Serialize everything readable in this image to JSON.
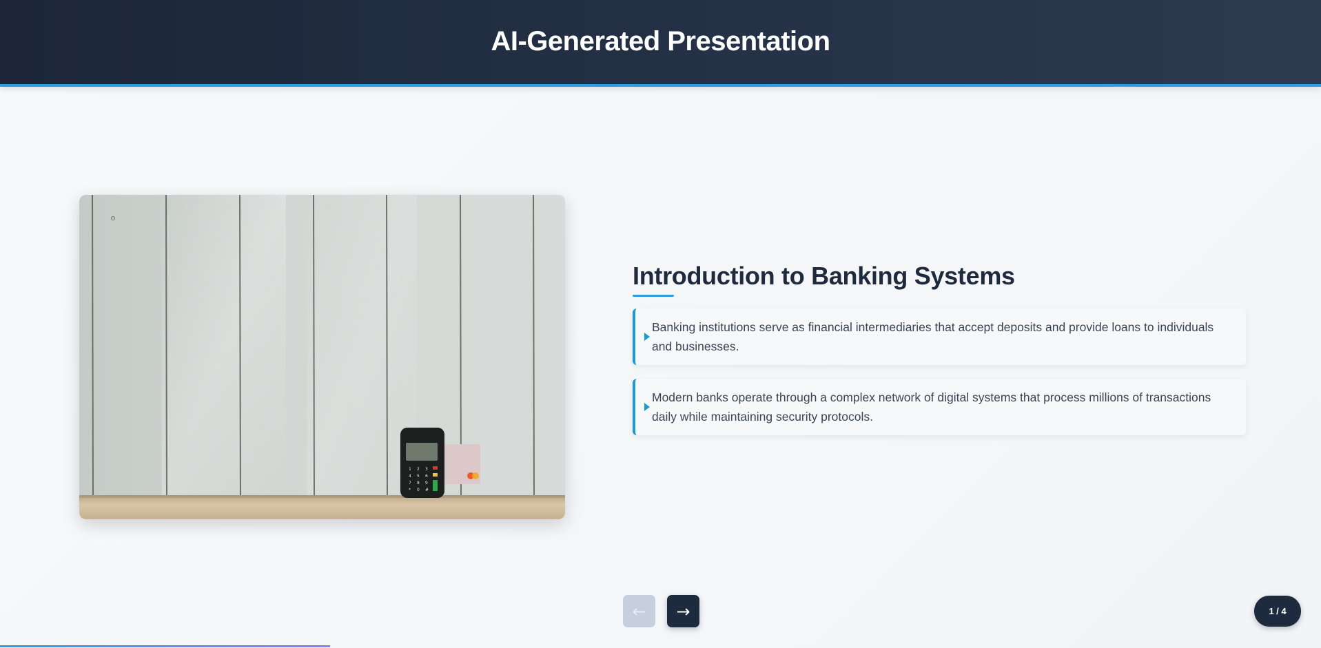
{
  "header": {
    "title": "AI-Generated Presentation"
  },
  "slide": {
    "image_alt": "Card payment terminal and credit card on a wooden shelf against a white paneled wall",
    "title": "Introduction to Banking Systems",
    "bullets": [
      "Banking institutions serve as financial intermediaries that accept deposits and provide loans to individuals and businesses.",
      "Modern banks operate through a complex network of digital systems that process millions of transactions daily while maintaining security protocols."
    ]
  },
  "navigation": {
    "prev_label": "←",
    "next_label": "→",
    "prev_disabled": true,
    "counter": "1 / 4",
    "progress_fraction": 0.25
  },
  "colors": {
    "header_bg": "#1e2a3d",
    "accent": "#2a9de0",
    "text_dark": "#1e2a3d",
    "text_body": "#3b4556"
  },
  "icons": [
    "triangle-right-bullet-icon",
    "arrow-left-icon",
    "arrow-right-icon"
  ]
}
